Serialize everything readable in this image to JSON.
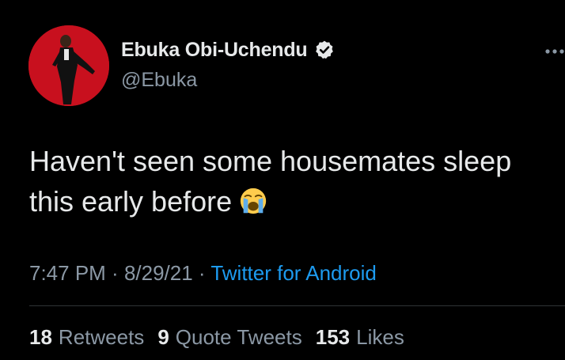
{
  "author": {
    "display_name": "Ebuka Obi-Uchendu",
    "handle": "@Ebuka",
    "verified": true,
    "avatar_icon": "profile-photo-man-in-suit-on-red",
    "verified_icon": "verified-badge-icon"
  },
  "tweet": {
    "text_line1": "Haven't seen some housemates sleep",
    "text_line2": "this early before",
    "emoji": "loudly-crying-face-emoji"
  },
  "meta": {
    "time": "7:47 PM",
    "sep1": " · ",
    "date": "8/29/21",
    "sep2": " · ",
    "source": "Twitter for Android"
  },
  "stats": {
    "retweets_count": "18",
    "retweets_label": "Retweets",
    "quote_count": "9",
    "quote_label": "Quote Tweets",
    "likes_count": "153",
    "likes_label": "Likes"
  },
  "colors": {
    "background": "#000000",
    "primary_text": "#e7e9ea",
    "secondary_text": "#8b98a5",
    "link": "#1d9bf0",
    "divider": "#2f3336",
    "avatar_bg": "#c8101e"
  }
}
